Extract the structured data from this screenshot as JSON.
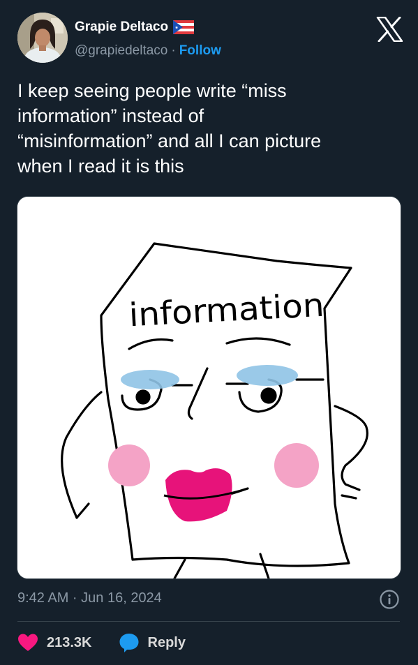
{
  "author": {
    "display_name": "Grapie Deltaco",
    "handle": "@grapiedeltaco",
    "separator": "·",
    "follow_label": "Follow"
  },
  "tweet": {
    "text_lines": [
      "I keep seeing people write “miss",
      "information” instead of",
      "“misinformation” and all I can picture",
      "when I read it is this"
    ],
    "image_text": "information",
    "timestamp": "9:42 AM · Jun 16, 2024"
  },
  "engagement": {
    "likes_count": "213.3K",
    "reply_label": "Reply"
  },
  "icons": {
    "flag": "puerto-rico-flag-icon",
    "brand": "x-logo-icon",
    "info": "info-icon",
    "like": "heart-icon",
    "reply": "speech-bubble-icon"
  },
  "colors": {
    "background": "#15202b",
    "text_primary": "#ffffff",
    "text_secondary": "#8b98a5",
    "accent_blue": "#1d9bf0",
    "like_pink": "#f91880",
    "divider": "#38444d"
  }
}
